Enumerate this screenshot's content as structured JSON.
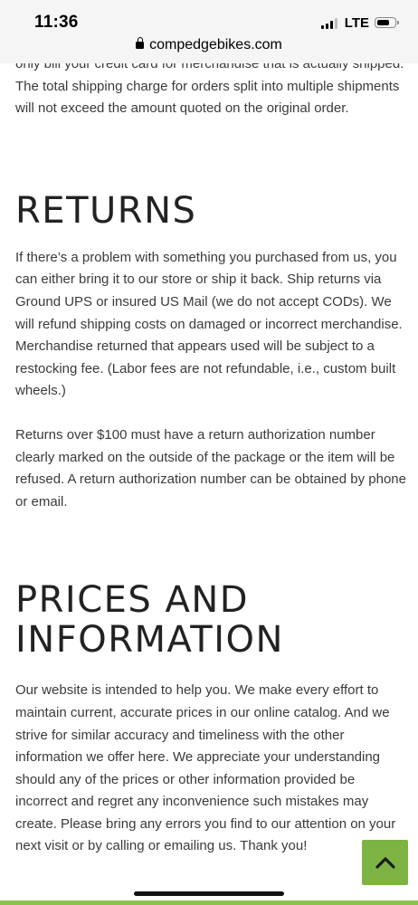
{
  "status_bar": {
    "time": "11:36",
    "network": "LTE",
    "battery_level": 0.7
  },
  "browser": {
    "url": "compedgebikes.com"
  },
  "content": {
    "shipping_tail": "only bill your credit card for merchandise that is actually shipped. The total shipping charge for orders split into multiple shipments will not exceed the amount quoted on the original order.",
    "returns_heading": "RETURNS",
    "returns_p1": "If there’s a problem with something you purchased from us, you can either bring it to our store or ship it back. Ship returns via Ground UPS or insured US Mail (we do not accept CODs). We will refund shipping costs on damaged or incorrect merchandise. Merchandise returned that appears used will be subject to a restocking fee. (Labor fees are not refundable, i.e., custom built wheels.)",
    "returns_p2": "Returns over $100 must have a return authorization number clearly marked on the outside of the package or the item will be refused. A return authorization number can be obtained by phone or email.",
    "prices_heading": "PRICES AND INFORMATION",
    "prices_p1": "Our website is intended to help you. We make every effort to maintain current, accurate prices in our online catalog. And we strive for similar accuracy and timeliness with the other information we offer here. We appreciate your understanding should any of the prices or other information provided be incorrect and regret any inconvenience such mistakes may create. Please bring any errors you find to our attention on your next visit or by calling or emailing us. Thank you!"
  },
  "scroll_top": {
    "icon": "chevron-up-icon"
  },
  "colors": {
    "accent": "#7cb342",
    "bottom_strip": "#8bc34a",
    "text": "#3a3a3a",
    "heading": "#222222",
    "chrome_bg": "#f5f5f5"
  }
}
